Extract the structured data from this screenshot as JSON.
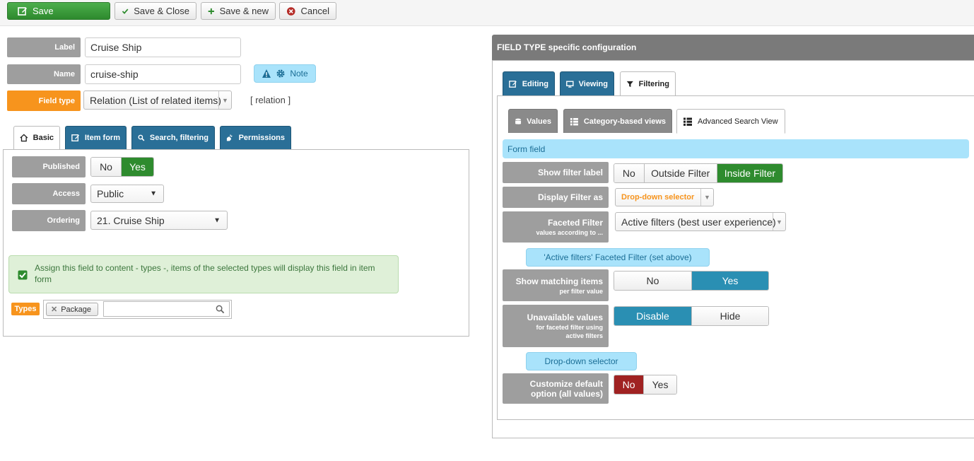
{
  "toolbar": {
    "save": "Save",
    "save_close": "Save & Close",
    "save_new": "Save & new",
    "cancel": "Cancel"
  },
  "left": {
    "label_lbl": "Label",
    "label_val": "Cruise Ship",
    "name_lbl": "Name",
    "name_val": "cruise-ship",
    "note_btn": "Note",
    "fieldtype_lbl": "Field type",
    "fieldtype_val": "Relation (List of related items)",
    "fieldtype_code": "[ relation ]",
    "tabs": [
      "Basic",
      "Item form",
      "Search, filtering",
      "Permissions"
    ],
    "published_lbl": "Published",
    "published_no": "No",
    "published_yes": "Yes",
    "access_lbl": "Access",
    "access_val": "Public",
    "ordering_lbl": "Ordering",
    "ordering_val": "21. Cruise Ship",
    "assign_text": "Assign this field to content - types -, items of the selected types will display this field in item form",
    "types_lbl": "Types",
    "types_tag": "Package"
  },
  "right": {
    "header": "FIELD TYPE specific configuration",
    "tabs": [
      "Editing",
      "Viewing",
      "Filtering"
    ],
    "subtabs": [
      "Values",
      "Category-based views",
      "Advanced Search View"
    ],
    "form_field": "Form field",
    "show_filter_label": "Show filter label",
    "sfl_opts": [
      "No",
      "Outside Filter",
      "Inside Filter"
    ],
    "display_filter_as": "Display Filter as",
    "dfa_val": "Drop-down selector",
    "faceted_lbl": "Faceted Filter",
    "faceted_sub": "values according to ...",
    "faceted_val": "Active filters (best user experience)",
    "faceted_note": "'Active filters' Faceted Filter (set above)",
    "show_matching": "Show matching items",
    "show_matching_sub": "per filter value",
    "sm_no": "No",
    "sm_yes": "Yes",
    "unavail": "Unavailable values",
    "unavail_sub1": "for faceted filter using",
    "unavail_sub2": "active filters",
    "ua_disable": "Disable",
    "ua_hide": "Hide",
    "dropdown_note": "Drop-down selector",
    "customize1": "Customize default",
    "customize2": "option (all values)",
    "cust_no": "No",
    "cust_yes": "Yes"
  },
  "colors": {
    "green": "#2e8b2e",
    "blue_tab": "#2a6f97",
    "orange": "#f7941d",
    "grey_label": "#9e9e9e",
    "red": "#a02222",
    "teal": "#2a8fb3"
  }
}
